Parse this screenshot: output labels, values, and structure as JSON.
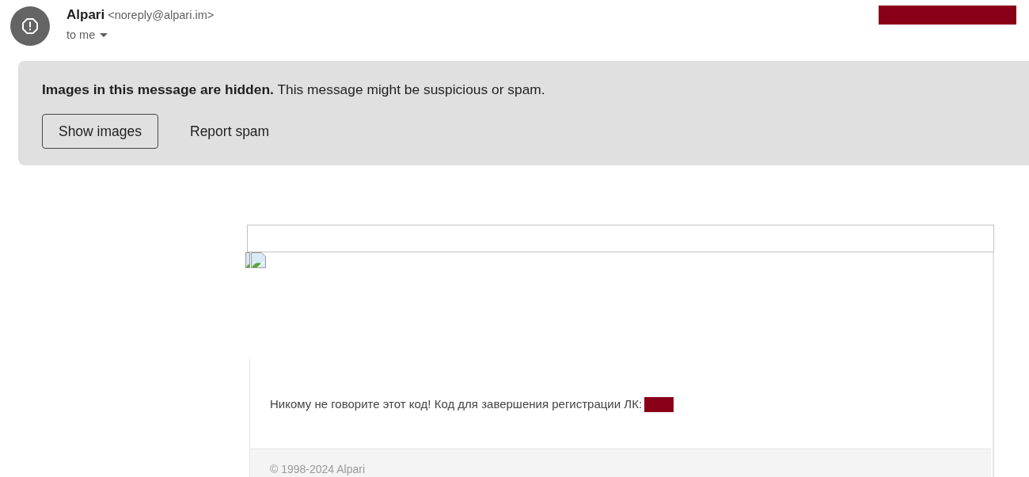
{
  "sender": {
    "name": "Alpari",
    "email": "<noreply@alpari.im>",
    "recipient": "to me"
  },
  "warning": {
    "message": "**Images in this message are hidden.** This message might be suspicious or spam.",
    "buttons": [
      {
        "label": "Show images",
        "kind": "outlined"
      },
      {
        "label": "Report spam",
        "kind": "text"
      }
    ]
  },
  "body": {
    "message": "Никому не говорите этот код! Код для завершения регистрации ЛК:",
    "footer": "© 1998-2024 Alpari"
  }
}
